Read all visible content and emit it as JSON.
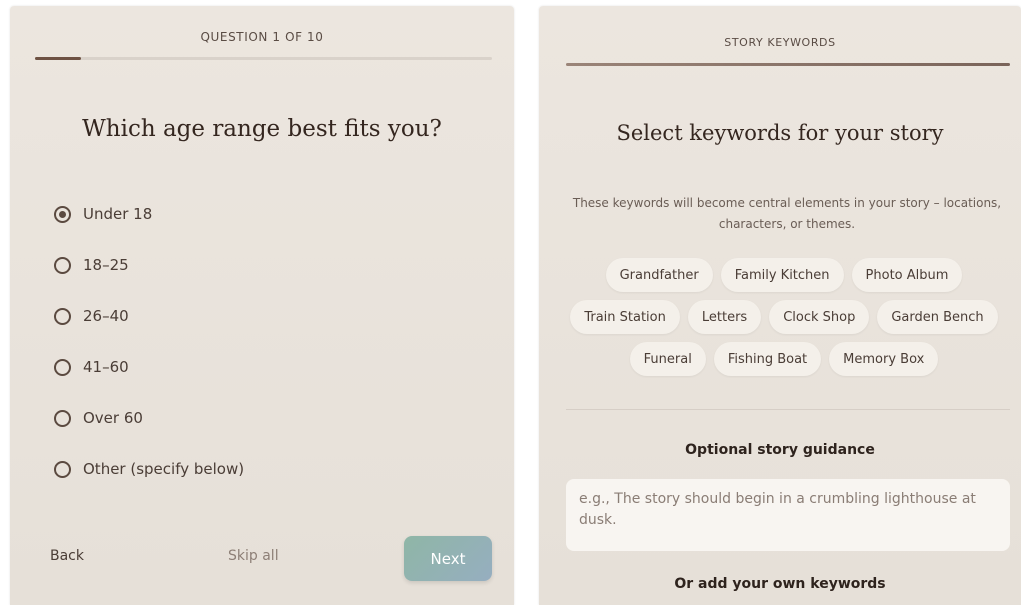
{
  "quiz": {
    "progress_label": "QUESTION 1 OF 10",
    "progress_fraction": 0.1,
    "question": "Which age range best fits you?",
    "options": [
      "Under 18",
      "18–25",
      "26–40",
      "41–60",
      "Over 60",
      "Other (specify below)"
    ],
    "selected_index": 0,
    "back_label": "Back",
    "skip_label": "Skip all",
    "next_label": "Next"
  },
  "keywords": {
    "header": "STORY KEYWORDS",
    "progress_fraction": 1.0,
    "title": "Select keywords for your story",
    "description": "These keywords will become central elements in your story – locations, characters, or themes.",
    "chips": [
      [
        "Grandfather",
        "Family Kitchen",
        "Photo Album"
      ],
      [
        "Train Station",
        "Letters",
        "Clock Shop",
        "Garden Bench"
      ],
      [
        "Funeral",
        "Fishing Boat",
        "Memory Box"
      ]
    ],
    "guidance_heading": "Optional story guidance",
    "guidance_placeholder": "e.g., The story should begin in a crumbling lighthouse at dusk.",
    "own_keywords_heading": "Or add your own keywords"
  },
  "colors": {
    "accent_brown": "#6e5243",
    "next_gradient_start": "#8fb6a6",
    "next_gradient_end": "#96aec0",
    "panel_bg": "#ece6df"
  }
}
